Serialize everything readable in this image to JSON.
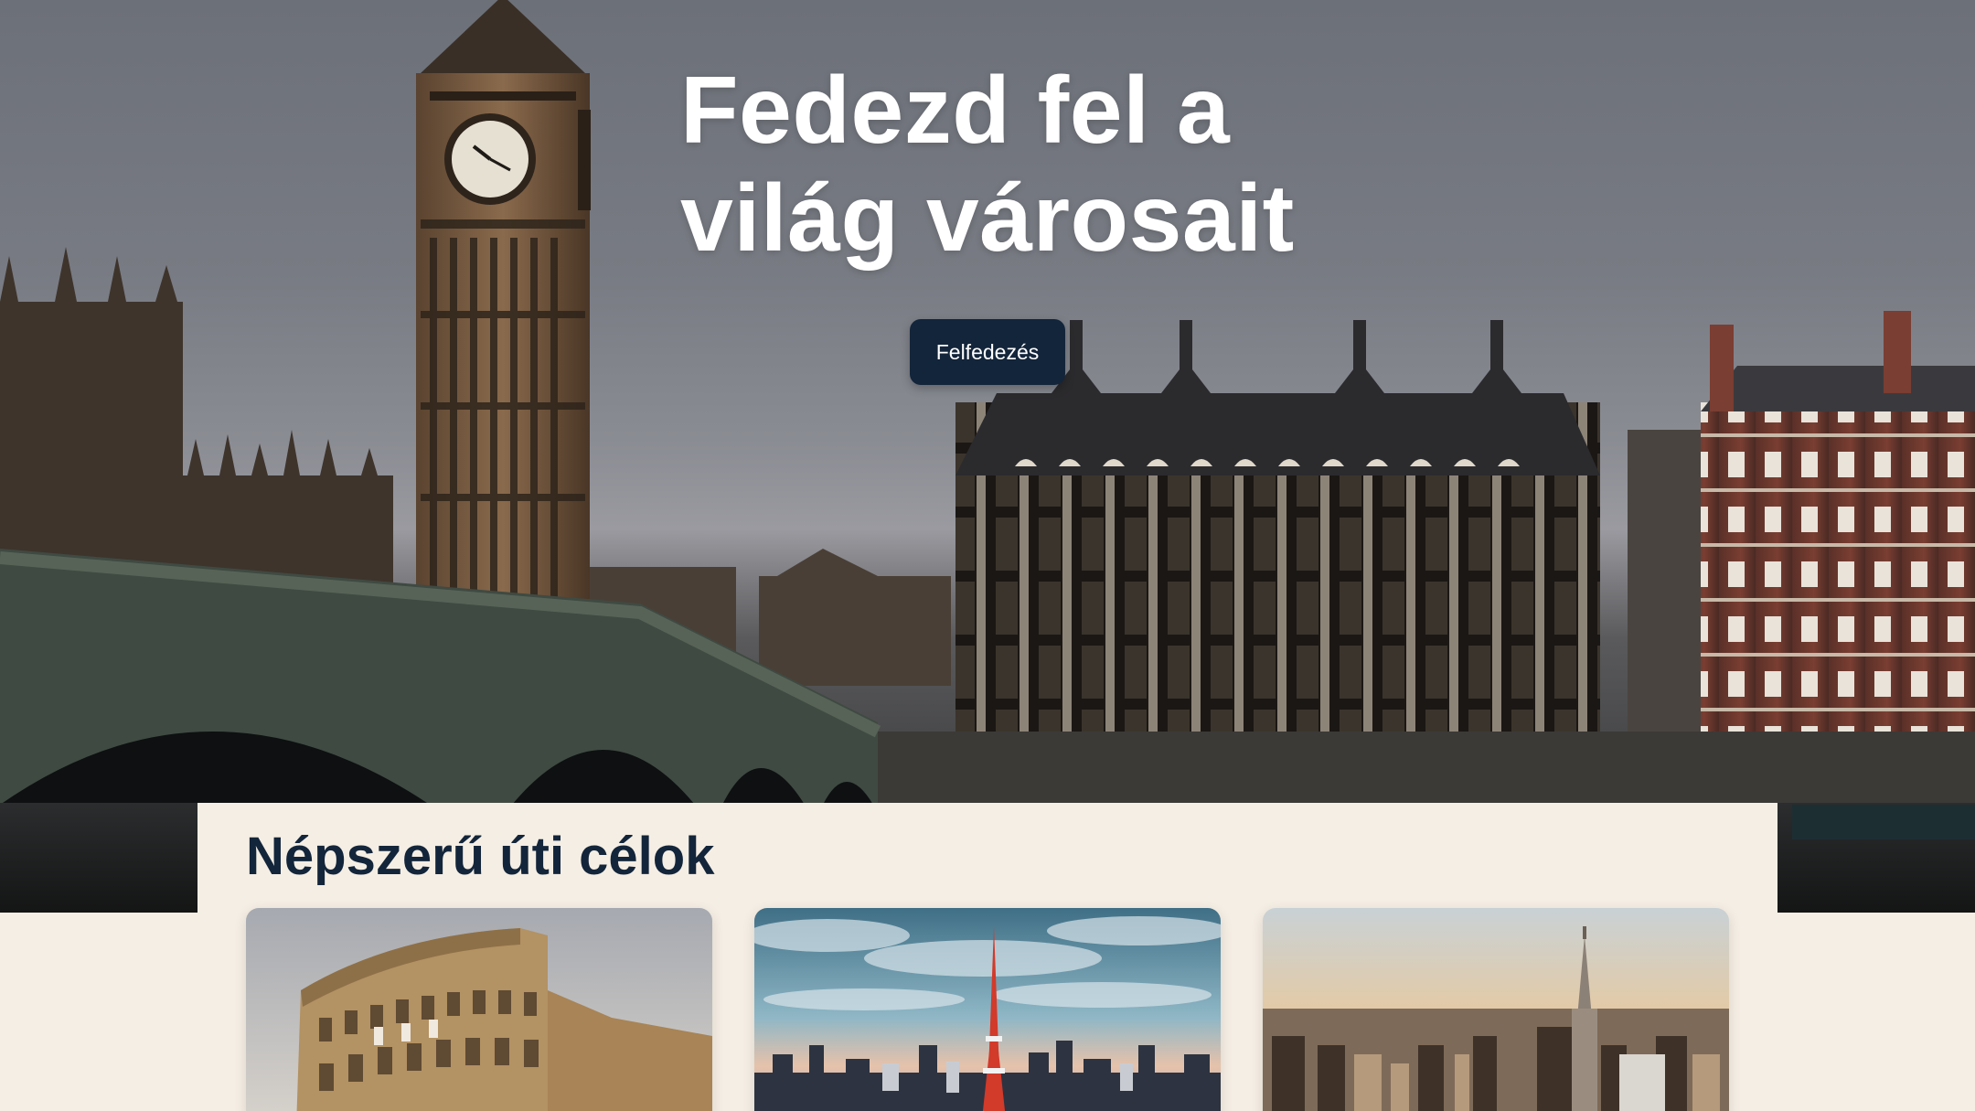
{
  "hero": {
    "title": "Fedezd fel a világ városait",
    "button_label": "Felfedezés",
    "image": "london-westminster-photo"
  },
  "destinations": {
    "heading": "Népszerű úti célok",
    "cards": [
      {
        "image": "colosseum-rome-photo"
      },
      {
        "image": "tokyo-tower-skyline-photo"
      },
      {
        "image": "new-york-skyline-photo"
      }
    ]
  },
  "colors": {
    "primary": "#13253a",
    "background": "#f5eee4",
    "hero_text": "#ffffff"
  }
}
